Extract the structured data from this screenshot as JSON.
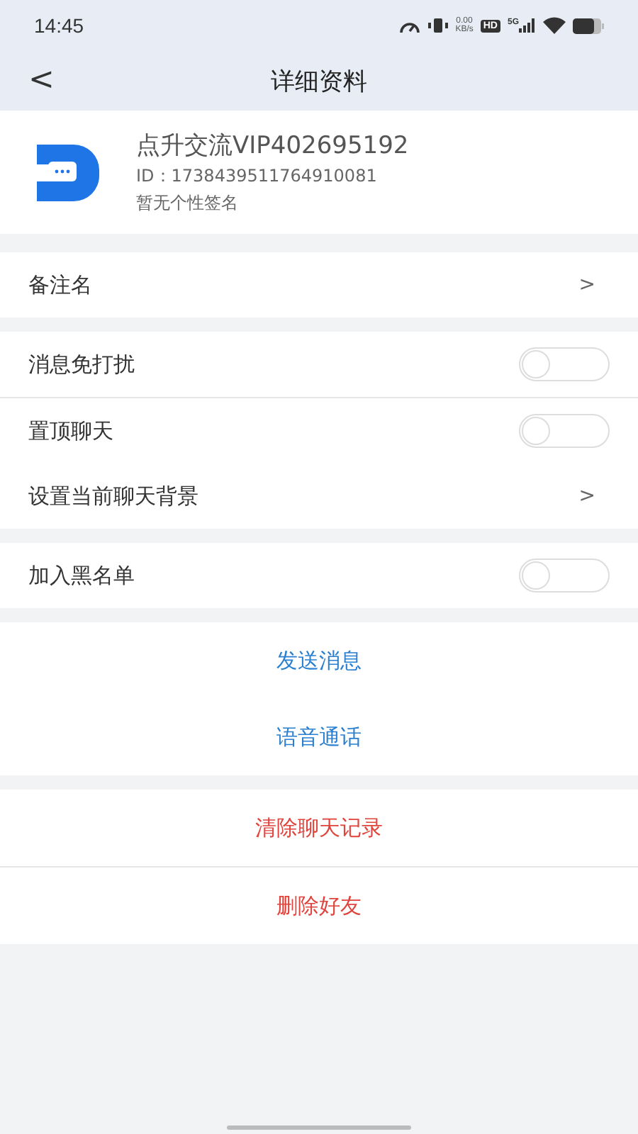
{
  "status_bar": {
    "time": "14:45",
    "net_speed": "0.00",
    "net_unit": "KB/s",
    "hd": "HD",
    "network": "5G"
  },
  "header": {
    "back": "<",
    "title": "详细资料"
  },
  "profile": {
    "name": "点升交流VIP402695192",
    "id": "ID：1738439511764910081",
    "signature": "暂无个性签名"
  },
  "groups": [
    {
      "items": [
        {
          "kind": "link",
          "label": "备注名",
          "arrow": ">"
        }
      ]
    },
    {
      "items": [
        {
          "kind": "toggle",
          "label": "消息免打扰",
          "on": false,
          "divider": true
        },
        {
          "kind": "toggle",
          "label": "置顶聊天",
          "on": false,
          "divider": false
        },
        {
          "kind": "link",
          "label": "设置当前聊天背景",
          "arrow": ">"
        }
      ]
    },
    {
      "items": [
        {
          "kind": "toggle",
          "label": "加入黑名单",
          "on": false,
          "divider": false
        }
      ]
    },
    {
      "items": [
        {
          "kind": "action",
          "label": "发送消息",
          "color": "#2a7fd0",
          "divider": false
        },
        {
          "kind": "action",
          "label": "语音通话",
          "color": "#2a7fd0",
          "divider": false
        }
      ]
    },
    {
      "items": [
        {
          "kind": "action",
          "label": "清除聊天记录",
          "color": "#e0443c",
          "divider": true
        },
        {
          "kind": "action",
          "label": "删除好友",
          "color": "#e0443c",
          "divider": false
        }
      ]
    }
  ]
}
